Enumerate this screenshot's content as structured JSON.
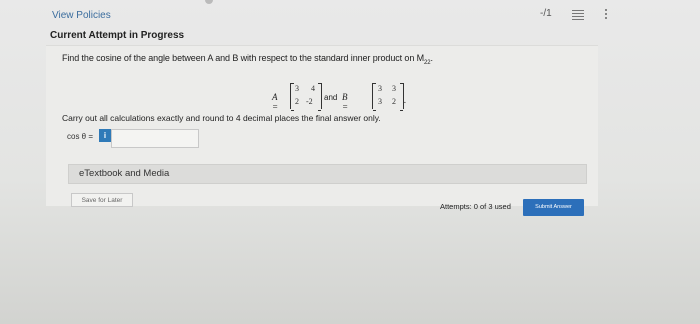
{
  "header": {
    "view_policies": "View Policies",
    "score": "-/1",
    "icons": [
      "list-icon",
      "kebab-menu-icon"
    ]
  },
  "attempt": {
    "title": "Current Attempt in Progress"
  },
  "question": {
    "prompt": "Find the cosine of the angle between A and B with respect to the standard inner product on M",
    "prompt_sub": "22",
    "prompt_end": ".",
    "matrix_a_label": "A =",
    "matrix_a": [
      [
        "3",
        "4"
      ],
      [
        "2",
        "-2"
      ]
    ],
    "and_text": "and",
    "matrix_b_label": "B =",
    "matrix_b": [
      [
        "3",
        "3"
      ],
      [
        "3",
        "2"
      ]
    ],
    "matrix_end": ".",
    "instructions": "Carry out all calculations exactly and round to 4 decimal places the final answer only."
  },
  "answer": {
    "label": "cos θ =",
    "info_icon": "i",
    "value": ""
  },
  "resources": {
    "etextbook_label": "eTextbook and Media"
  },
  "footer": {
    "save_label": "Save for Later",
    "attempts_text": "Attempts: 0 of 3 used",
    "submit_label": "Submit Answer"
  },
  "colors": {
    "accent": "#2c6fba",
    "link": "#3b6d9e"
  }
}
